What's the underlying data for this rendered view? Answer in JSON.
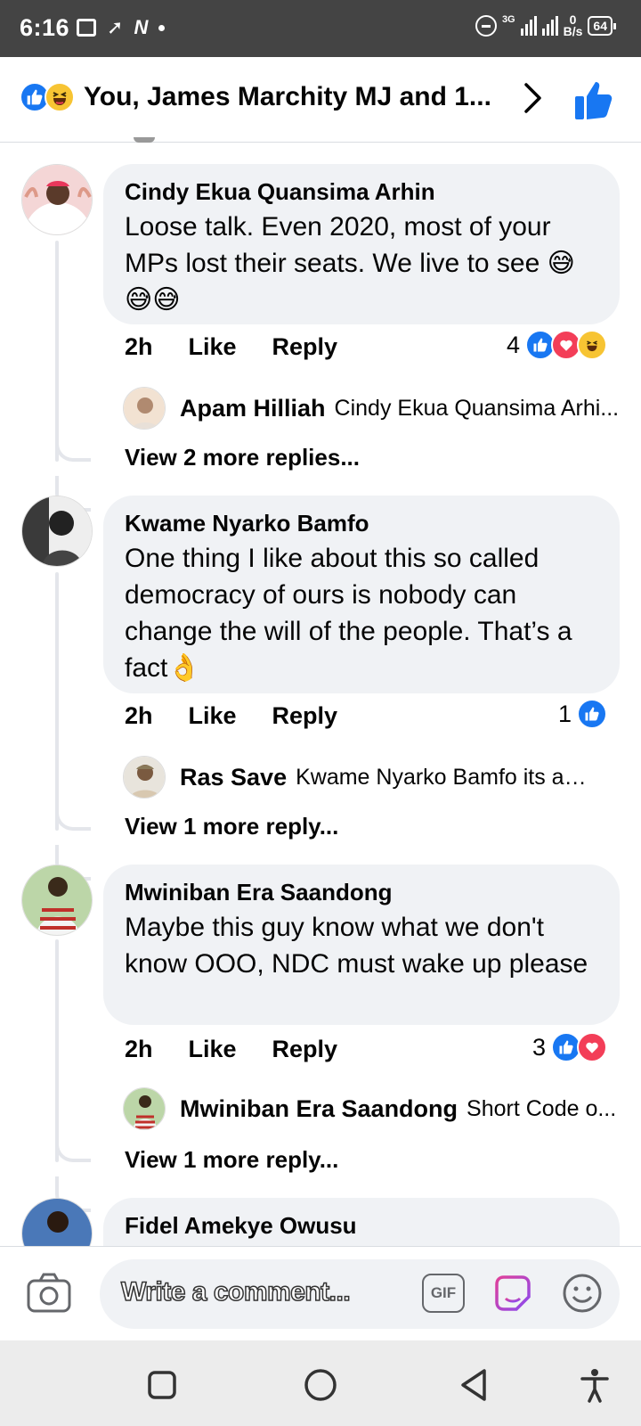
{
  "status_bar": {
    "time": "6:16",
    "network": "3G",
    "speed_value": "0",
    "speed_unit": "B/s",
    "battery": "64"
  },
  "header": {
    "title": "You, James Marchity MJ and 1...",
    "reaction_icons": [
      "like-icon",
      "haha-icon"
    ]
  },
  "comments": [
    {
      "name": "Cindy Ekua Quansima Arhin",
      "text": "Loose talk. Even 2020, most of your MPs lost their seats. We live to see 😅😅😅",
      "time": "2h",
      "like_label": "Like",
      "reply_label": "Reply",
      "reaction_count": "4",
      "reactions": [
        "like",
        "love",
        "haha"
      ],
      "reply_preview": {
        "name": "Apam Hilliah",
        "text": "Cindy Ekua Quansima Arhi..."
      },
      "more_replies": "View 2 more replies..."
    },
    {
      "name": "Kwame Nyarko Bamfo",
      "text": "One thing I like about this so called democracy of ours is nobody can change the will of the people. That’s a fact👌",
      "time": "2h",
      "like_label": "Like",
      "reply_label": "Reply",
      "reaction_count": "1",
      "reactions": [
        "like"
      ],
      "reply_preview": {
        "name": "Ras Save",
        "text": "Kwame Nyarko Bamfo its a lie..."
      },
      "more_replies": "View 1 more reply..."
    },
    {
      "name": "Mwiniban Era Saandong",
      "text": "Maybe this guy know what we don't know OOO, NDC must wake up please",
      "time": "2h",
      "like_label": "Like",
      "reply_label": "Reply",
      "reaction_count": "3",
      "reactions": [
        "like",
        "love"
      ],
      "reply_preview": {
        "name": "Mwiniban Era Saandong",
        "text": "Short Code o..."
      },
      "more_replies": "View 1 more reply..."
    },
    {
      "name": "Fidel Amekye Owusu"
    }
  ],
  "composer": {
    "placeholder": "Write a comment...",
    "gif_label": "GIF"
  },
  "colors": {
    "accent": "#1877f2",
    "love": "#f33e58",
    "haha": "#f7c433",
    "bubble": "#f0f2f5"
  }
}
